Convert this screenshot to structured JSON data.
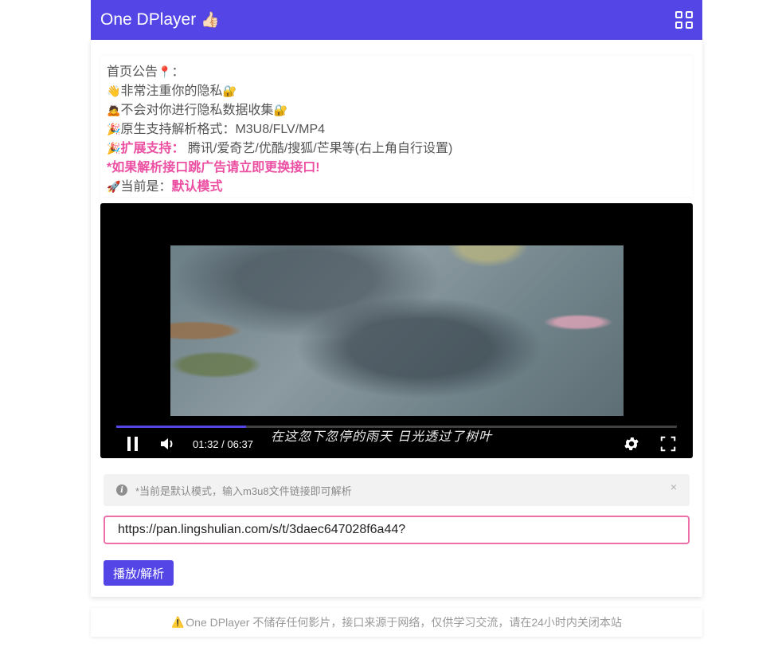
{
  "header": {
    "title": "One DPlayer",
    "title_emoji": "👍🏻",
    "menu_icon": "grid-icon",
    "accent_color": "#5446e6"
  },
  "notice": {
    "heading": "首页公告",
    "heading_emoji": "📍",
    "heading_suffix": "：",
    "line1_emoji": "👋",
    "line1": "非常注重你的隐私",
    "line1_end_emoji": "🔐",
    "line2_emoji": "🙇",
    "line2": "不会对你进行隐私数据收集",
    "line2_end_emoji": "🔐",
    "line3_emoji": "🎉",
    "line3": "原生支持解析格式：M3U8/FLV/MP4",
    "line4_emoji": "🎉",
    "line4_label": "扩展支持：",
    "line4": " 腾讯/爱奇艺/优酷/搜狐/芒果等(右上角自行设置)",
    "warning": "*如果解析接口跳广告请立即更换接口!",
    "line6_emoji": "🚀",
    "line6_label": "当前是：",
    "mode": "默认模式",
    "highlight_color": "#ec4fa2"
  },
  "player": {
    "subtitle": "在这忽下忽停的雨天 日光透过了树叶",
    "current_time": "01:32",
    "separator": " / ",
    "duration": "06:37",
    "progress_fraction": 0.2317,
    "icons": [
      "pause-icon",
      "volume-icon",
      "gear-icon",
      "fullscreen-icon"
    ]
  },
  "alert": {
    "text": "*当前是默认模式，输入m3u8文件链接即可解析",
    "close": "×",
    "icon": "info-icon"
  },
  "input": {
    "value": "https://pan.lingshulian.com/s/t/3daec647028f6a44?"
  },
  "actions": {
    "play_label": "播放/解析"
  },
  "footer": {
    "warn_emoji": "⚠️",
    "text": "One DPlayer 不储存任何影片，接口来源于网络，仅供学习交流，请在24小时内关闭本站"
  }
}
